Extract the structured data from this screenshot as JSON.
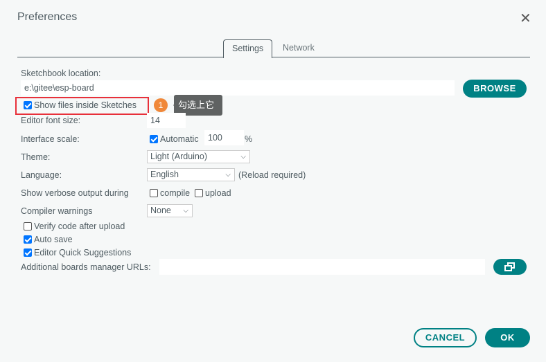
{
  "window": {
    "title": "Preferences",
    "close_icon": "close-icon"
  },
  "tabs": [
    {
      "label": "Settings",
      "active": true
    },
    {
      "label": "Network",
      "active": false
    }
  ],
  "sketchbook": {
    "label": "Sketchbook location:",
    "value": "e:\\gitee\\esp-board",
    "browse": "BROWSE"
  },
  "show_files": {
    "label": "Show files inside Sketches",
    "checked": true
  },
  "annotation": {
    "number": "1",
    "text": "勾选上它",
    "badge_color": "#f0883a",
    "highlight_color": "#e8303a"
  },
  "font_size": {
    "label": "Editor font size:",
    "value": "14"
  },
  "interface_scale": {
    "label": "Interface scale:",
    "automatic_label": "Automatic",
    "automatic": true,
    "value": "100",
    "unit": "%"
  },
  "theme": {
    "label": "Theme:",
    "value": "Light (Arduino)"
  },
  "language": {
    "label": "Language:",
    "value": "English",
    "note": "(Reload required)"
  },
  "verbose": {
    "label": "Show verbose output during",
    "compile": "compile",
    "compile_checked": false,
    "upload": "upload",
    "upload_checked": false
  },
  "warnings": {
    "label": "Compiler warnings",
    "value": "None"
  },
  "options": [
    {
      "label": "Verify code after upload",
      "checked": false
    },
    {
      "label": "Auto save",
      "checked": true
    },
    {
      "label": "Editor Quick Suggestions",
      "checked": true
    }
  ],
  "boards": {
    "label": "Additional boards manager URLs:",
    "value": ""
  },
  "footer": {
    "cancel": "CANCEL",
    "ok": "OK"
  },
  "colors": {
    "accent": "#008184",
    "background": "#f6f8f8"
  }
}
